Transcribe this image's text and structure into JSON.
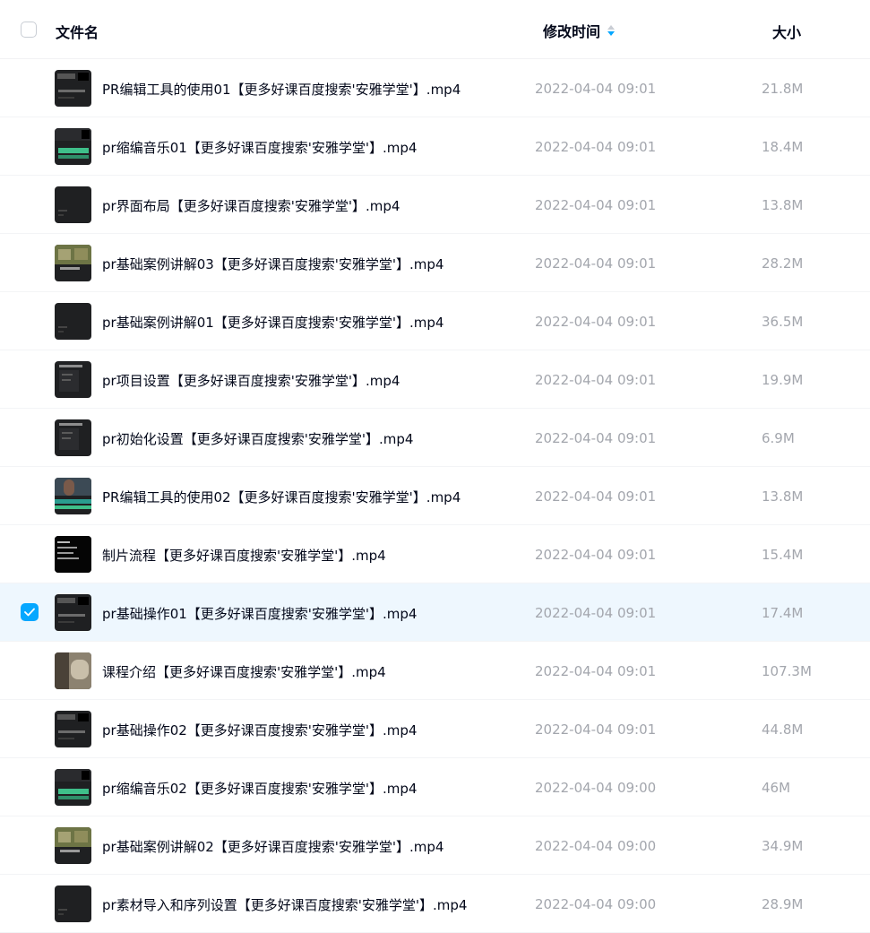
{
  "header": {
    "name_label": "文件名",
    "time_label": "修改时间",
    "size_label": "大小",
    "sort_icon": "sort-descending-icon"
  },
  "colors": {
    "accent": "#06a7ff",
    "selected_row_bg": "#eef7fe",
    "muted_text": "#a3a6ad",
    "primary_text": "#03081a"
  },
  "files": [
    {
      "name": "PR编辑工具的使用01【更多好课百度搜索'安雅学堂'】.mp4",
      "date": "2022-04-04 09:01",
      "size": "21.8M",
      "selected": false,
      "thumb": "dark-ui"
    },
    {
      "name": "pr缩编音乐01【更多好课百度搜索'安雅学堂'】.mp4",
      "date": "2022-04-04 09:01",
      "size": "18.4M",
      "selected": false,
      "thumb": "green-wave"
    },
    {
      "name": "pr界面布局【更多好课百度搜索'安雅学堂'】.mp4",
      "date": "2022-04-04 09:01",
      "size": "13.8M",
      "selected": false,
      "thumb": "dark"
    },
    {
      "name": "pr基础案例讲解03【更多好课百度搜索'安雅学堂'】.mp4",
      "date": "2022-04-04 09:01",
      "size": "28.2M",
      "selected": false,
      "thumb": "olive"
    },
    {
      "name": "pr基础案例讲解01【更多好课百度搜索'安雅学堂'】.mp4",
      "date": "2022-04-04 09:01",
      "size": "36.5M",
      "selected": false,
      "thumb": "dark"
    },
    {
      "name": "pr项目设置【更多好课百度搜索'安雅学堂'】.mp4",
      "date": "2022-04-04 09:01",
      "size": "19.9M",
      "selected": false,
      "thumb": "dark-dialog"
    },
    {
      "name": "pr初始化设置【更多好课百度搜索'安雅学堂'】.mp4",
      "date": "2022-04-04 09:01",
      "size": "6.9M",
      "selected": false,
      "thumb": "dark-dialog"
    },
    {
      "name": "PR编辑工具的使用02【更多好课百度搜索'安雅学堂'】.mp4",
      "date": "2022-04-04 09:01",
      "size": "13.8M",
      "selected": false,
      "thumb": "photo-teal"
    },
    {
      "name": "制片流程【更多好课百度搜索'安雅学堂'】.mp4",
      "date": "2022-04-04 09:01",
      "size": "15.4M",
      "selected": false,
      "thumb": "black-text"
    },
    {
      "name": "pr基础操作01【更多好课百度搜索'安雅学堂'】.mp4",
      "date": "2022-04-04 09:01",
      "size": "17.4M",
      "selected": true,
      "thumb": "dark-ui"
    },
    {
      "name": "课程介绍【更多好课百度搜索'安雅学堂'】.mp4",
      "date": "2022-04-04 09:01",
      "size": "107.3M",
      "selected": false,
      "thumb": "photo-rock"
    },
    {
      "name": "pr基础操作02【更多好课百度搜索'安雅学堂'】.mp4",
      "date": "2022-04-04 09:01",
      "size": "44.8M",
      "selected": false,
      "thumb": "dark-ui"
    },
    {
      "name": "pr缩编音乐02【更多好课百度搜索'安雅学堂'】.mp4",
      "date": "2022-04-04 09:00",
      "size": "46M",
      "selected": false,
      "thumb": "green-wave"
    },
    {
      "name": "pr基础案例讲解02【更多好课百度搜索'安雅学堂'】.mp4",
      "date": "2022-04-04 09:00",
      "size": "34.9M",
      "selected": false,
      "thumb": "olive"
    },
    {
      "name": "pr素材导入和序列设置【更多好课百度搜索'安雅学堂'】.mp4",
      "date": "2022-04-04 09:00",
      "size": "28.9M",
      "selected": false,
      "thumb": "dark"
    }
  ]
}
